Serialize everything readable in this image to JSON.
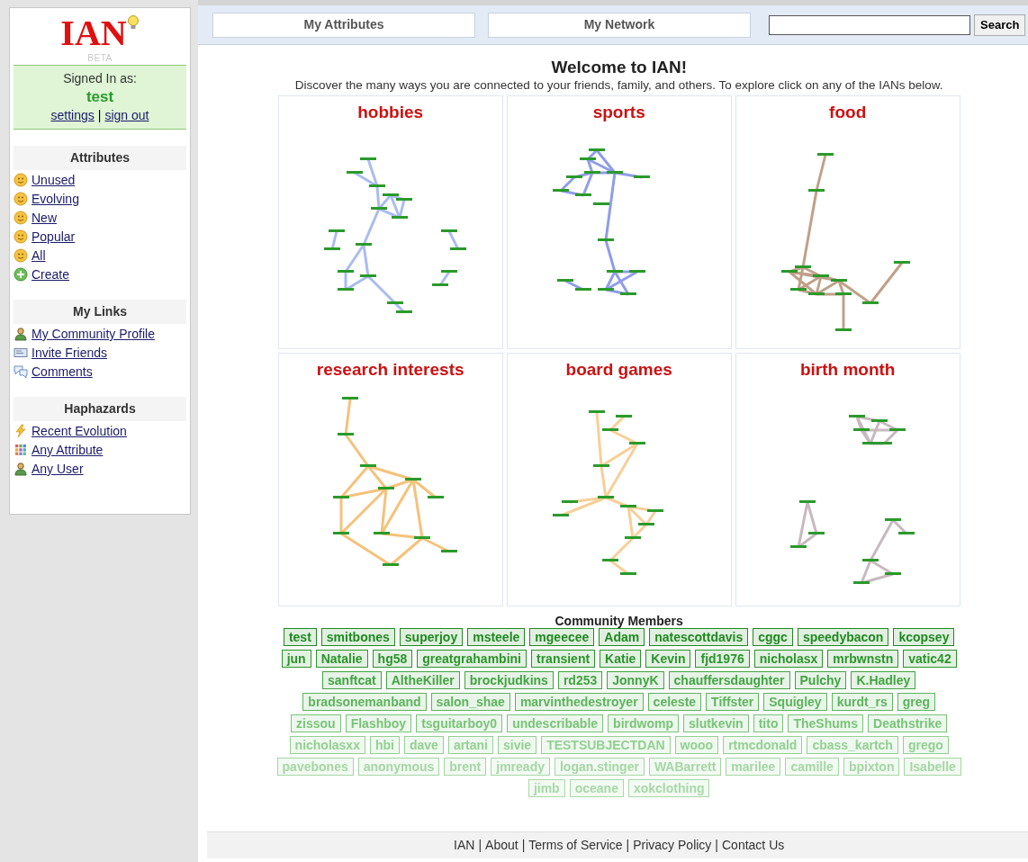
{
  "logo": {
    "text": "IAN",
    "badge": "BETA"
  },
  "account": {
    "label": "Signed In as:",
    "user": "test",
    "links": [
      "settings",
      "sign out"
    ],
    "separator": "|"
  },
  "sidebar": [
    {
      "title": "Attributes",
      "items": [
        {
          "label": "Unused",
          "kind": "smiley"
        },
        {
          "label": "Evolving",
          "kind": "smiley"
        },
        {
          "label": "New",
          "kind": "smiley"
        },
        {
          "label": "Popular",
          "kind": "smiley"
        },
        {
          "label": "All",
          "kind": "smiley"
        },
        {
          "label": "Create",
          "kind": "plus"
        }
      ]
    },
    {
      "title": "My Links",
      "items": [
        {
          "label": "My Community Profile",
          "kind": "user"
        },
        {
          "label": "Invite Friends",
          "kind": "mail"
        },
        {
          "label": "Comments",
          "kind": "comments"
        }
      ]
    },
    {
      "title": "Haphazards",
      "items": [
        {
          "label": "Recent Evolution",
          "kind": "lightning"
        },
        {
          "label": "Any Attribute",
          "kind": "grid"
        },
        {
          "label": "Any User",
          "kind": "user"
        }
      ]
    }
  ],
  "tabs": [
    {
      "label": "My Attributes"
    },
    {
      "label": "My Network"
    }
  ],
  "search": {
    "button": "Search"
  },
  "welcome": {
    "title": "Welcome to IAN!",
    "text": "Discover the many ways you are connected to your friends, family, and others. To explore click on any of the IANs below."
  },
  "networks": [
    {
      "title": "hobbies",
      "color": "#aabcf0"
    },
    {
      "title": "sports",
      "color": "#8f9de8"
    },
    {
      "title": "food",
      "color": "#c0a088"
    },
    {
      "title": "research interests",
      "color": "#f5c27a"
    },
    {
      "title": "board games",
      "color": "#f7cf98"
    },
    {
      "title": "birth month",
      "color": "#c8b8c0"
    }
  ],
  "members_title": "Community Members",
  "member_rows": [
    {
      "color": "#1e8a1e",
      "members": [
        "test",
        "smitbones",
        "superjoy",
        "msteele",
        "mgeecee",
        "Adam",
        "natescottdavis",
        "cggc",
        "speedybacon",
        "kcopsey"
      ]
    },
    {
      "color": "#2a942a",
      "members": [
        "jun",
        "Natalie",
        "hg58",
        "greatgrahambini",
        "transient",
        "Katie",
        "Kevin",
        "fjd1976",
        "nicholasx",
        "mrbwnstn",
        "vatic42"
      ]
    },
    {
      "color": "#42a442",
      "members": [
        "sanftcat",
        "AltheKiller",
        "brockjudkins",
        "rd253",
        "JonnyK",
        "chauffersdaughter",
        "Pulchy",
        "K.Hadley"
      ]
    },
    {
      "color": "#5cb45c",
      "members": [
        "bradsonemanband",
        "salon_shae",
        "marvinthedestroyer",
        "celeste",
        "Tiffster",
        "Squigley",
        "kurdt_rs",
        "greg"
      ]
    },
    {
      "color": "#78c478",
      "members": [
        "zissou",
        "Flashboy",
        "tsguitarboy0",
        "undescribable",
        "birdwomp",
        "slutkevin",
        "tito",
        "TheShums",
        "Deathstrike"
      ]
    },
    {
      "color": "#92d092",
      "members": [
        "nicholasxx",
        "hbi",
        "dave",
        "artani",
        "sivie",
        "TESTSUBJECTDAN",
        "wooo",
        "rtmcdonald",
        "cbass_kartch",
        "grego"
      ]
    },
    {
      "color": "#a4d6a4",
      "members": [
        "pavebones",
        "anonymous",
        "brent",
        "jmready",
        "logan.stinger",
        "WABarrett",
        "marilee",
        "camille",
        "bpixton",
        "Isabelle"
      ]
    },
    {
      "color": "#a8d8a8",
      "members": [
        "jimb",
        "oceane",
        "xokclothing"
      ]
    }
  ],
  "footer": [
    {
      "label": "IAN"
    },
    {
      "label": "About"
    },
    {
      "label": "Terms of Service"
    },
    {
      "label": "Privacy Policy"
    },
    {
      "label": "Contact Us"
    }
  ],
  "footer_separator": "|"
}
